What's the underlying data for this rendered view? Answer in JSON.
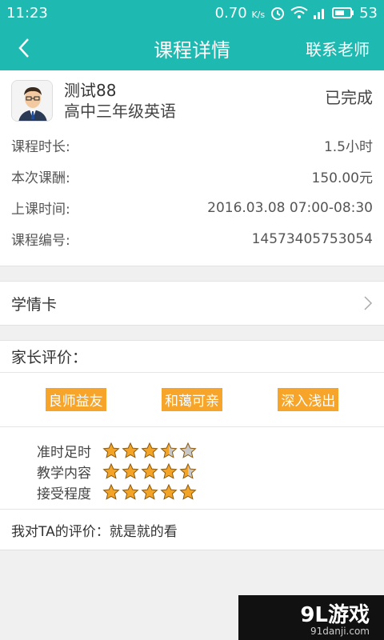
{
  "status": {
    "time": "11:23",
    "speed": "0.70",
    "speed_unit": "K/s",
    "battery": "53"
  },
  "nav": {
    "title": "课程详情",
    "contact": "联系老师"
  },
  "course": {
    "teacher": "测试88",
    "subject": "高中三年级英语",
    "status": "已完成",
    "rows": [
      {
        "label": "课程时长:",
        "value": "1.5小时"
      },
      {
        "label": "本次课酬:",
        "value": "150.00元"
      },
      {
        "label": "上课时间:",
        "value": "2016.03.08 07:00-08:30"
      },
      {
        "label": "课程编号:",
        "value": "14573405753054"
      }
    ]
  },
  "report_card": {
    "label": "学情卡"
  },
  "parent_eval": {
    "title": "家长评价：",
    "tags": [
      "良师益友",
      "和蔼可亲",
      "深入浅出"
    ],
    "ratings": [
      {
        "label": "准时足时",
        "score": 3.5
      },
      {
        "label": "教学内容",
        "score": 4.5
      },
      {
        "label": "接受程度",
        "score": 5
      }
    ]
  },
  "my_eval": {
    "label": "我对TA的评价：",
    "text": "就是就的看"
  },
  "watermark": {
    "main": "9L游戏",
    "sub": "91danji.com"
  },
  "colors": {
    "accent": "#1eb9b0",
    "tag": "#f6a52a",
    "star": "#f3a426",
    "star_empty": "#c8c8c8"
  }
}
